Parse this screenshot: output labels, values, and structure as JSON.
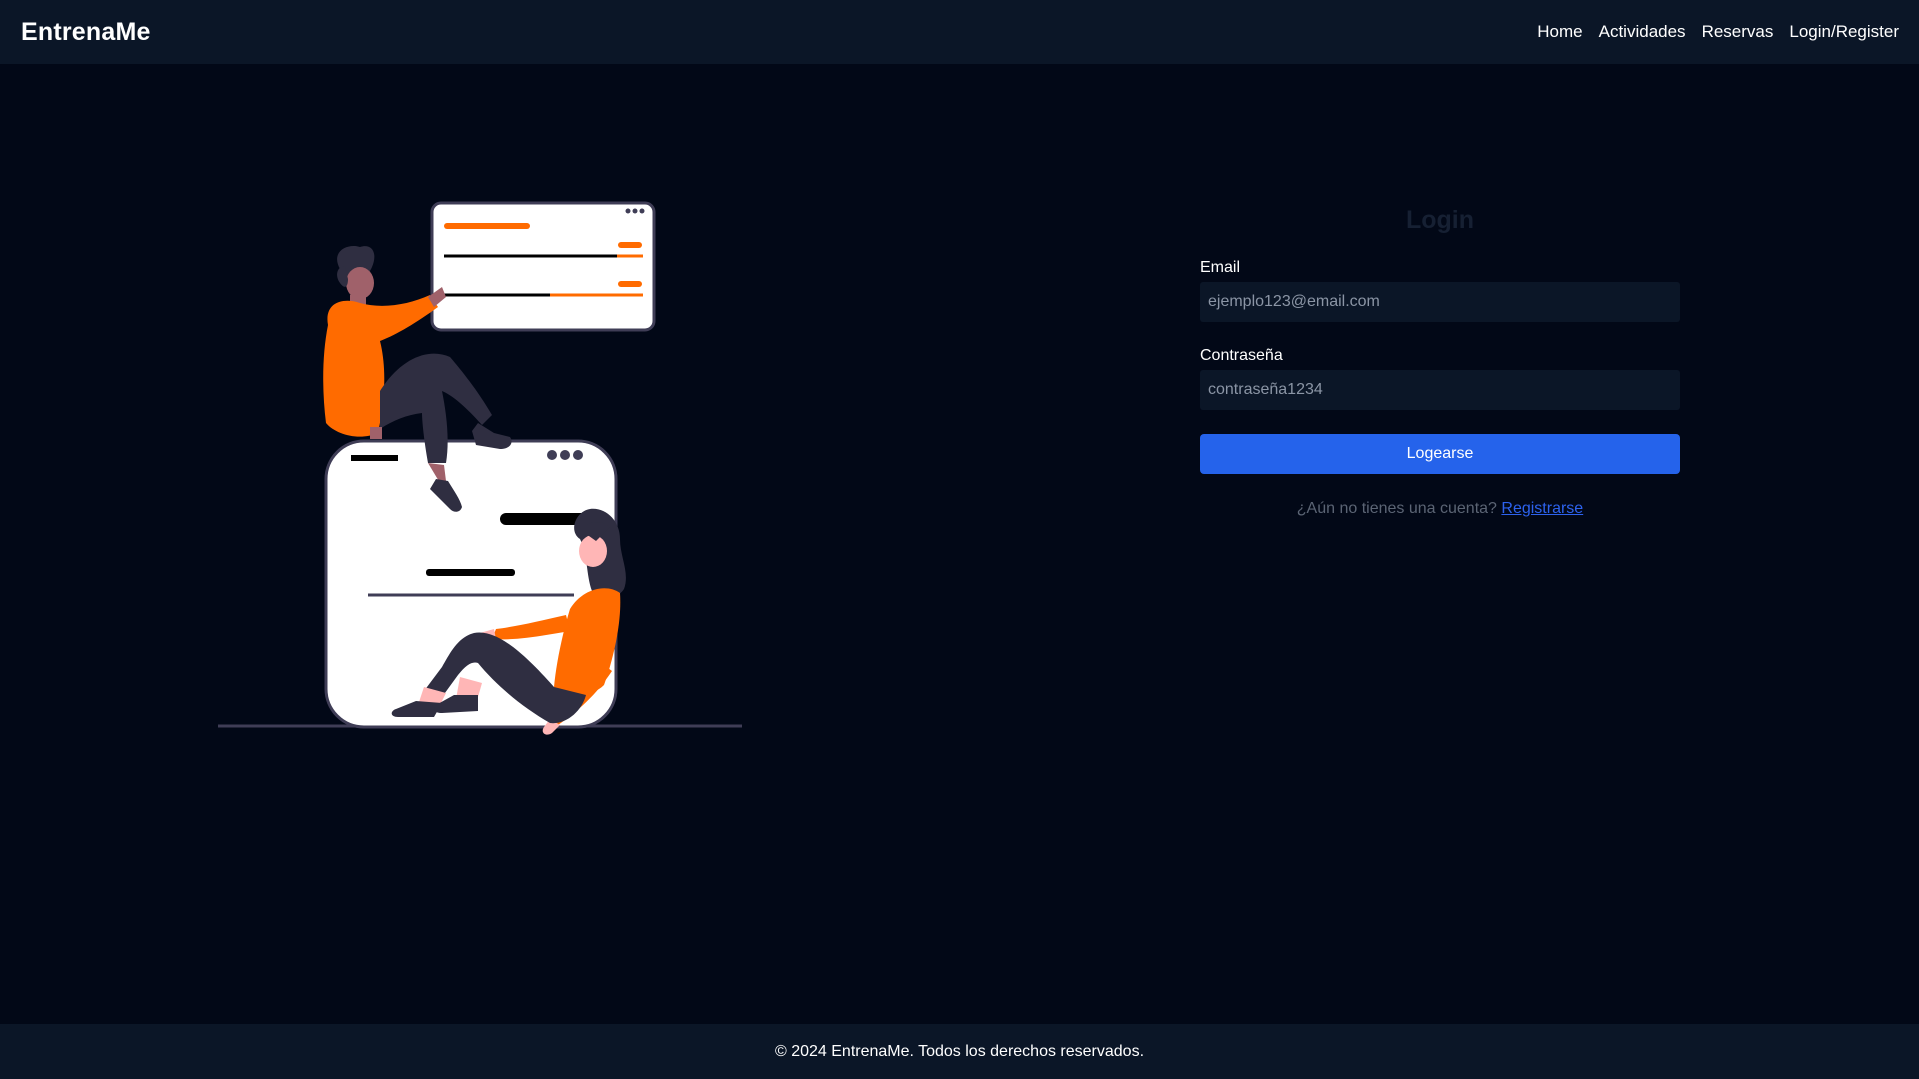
{
  "navbar": {
    "brand": "EntrenaMe",
    "links": [
      "Home",
      "Actividades",
      "Reservas",
      "Login/Register"
    ]
  },
  "login": {
    "title": "Login",
    "email_label": "Email",
    "email_placeholder": "ejemplo123@email.com",
    "password_label": "Contraseña",
    "password_placeholder": "contraseña1234",
    "submit_label": "Logearse",
    "register_prompt": "¿Aún no tienes una cuenta?",
    "register_link": "Registrarse"
  },
  "footer": {
    "text": "© 2024 EntrenaMe. Todos los derechos reservados."
  },
  "colors": {
    "background": "#020817",
    "bar": "#0b1627",
    "accent": "#2563eb",
    "illustration_accent": "#ff6b00"
  }
}
